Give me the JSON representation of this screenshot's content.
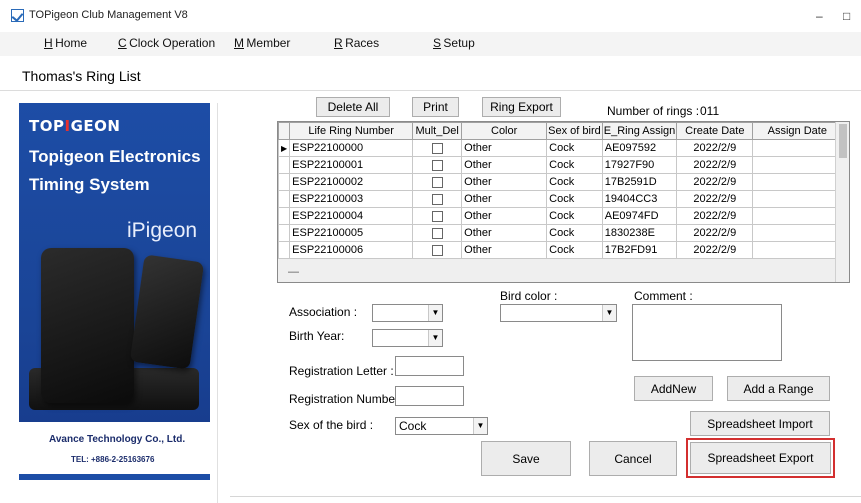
{
  "window": {
    "title": "TOPigeon Club Management V8",
    "minimize_glyph": "–",
    "maximize_glyph": "□"
  },
  "menu": [
    {
      "key": "H",
      "label": "Home"
    },
    {
      "key": "C",
      "label": "Clock Operation"
    },
    {
      "key": "M",
      "label": "Member"
    },
    {
      "key": "R",
      "label": "Races"
    },
    {
      "key": "S",
      "label": "Setup"
    }
  ],
  "page_title": "Thomas's Ring List",
  "banner": {
    "logo_prefix": "TOP",
    "logo_accent": "I",
    "logo_suffix": "GEON",
    "line1": "Topigeon Electronics",
    "line2": "Timing System",
    "product": "iPigeon",
    "company": "Avance Technology Co., Ltd.",
    "tel": "TEL: +886-2-25163676"
  },
  "toolbar": {
    "delete_all": "Delete All",
    "print": "Print",
    "ring_export": "Ring Export",
    "rings_label": "Number of rings :",
    "rings_count": "011"
  },
  "grid": {
    "columns": [
      "Life Ring Number",
      "Mult_Del",
      "Color",
      "Sex of bird",
      "E_Ring Assign",
      "Create Date",
      "Assign Date"
    ],
    "rows": [
      {
        "ring": "ESP22100000",
        "color": "Other",
        "sex": "Cock",
        "e_ring": "AE097592",
        "created": "2022/2/9",
        "assigned": ""
      },
      {
        "ring": "ESP22100001",
        "color": "Other",
        "sex": "Cock",
        "e_ring": "17927F90",
        "created": "2022/2/9",
        "assigned": ""
      },
      {
        "ring": "ESP22100002",
        "color": "Other",
        "sex": "Cock",
        "e_ring": "17B2591D",
        "created": "2022/2/9",
        "assigned": ""
      },
      {
        "ring": "ESP22100003",
        "color": "Other",
        "sex": "Cock",
        "e_ring": "19404CC3",
        "created": "2022/2/9",
        "assigned": ""
      },
      {
        "ring": "ESP22100004",
        "color": "Other",
        "sex": "Cock",
        "e_ring": "AE0974FD",
        "created": "2022/2/9",
        "assigned": ""
      },
      {
        "ring": "ESP22100005",
        "color": "Other",
        "sex": "Cock",
        "e_ring": "1830238E",
        "created": "2022/2/9",
        "assigned": ""
      },
      {
        "ring": "ESP22100006",
        "color": "Other",
        "sex": "Cock",
        "e_ring": "17B2FD91",
        "created": "2022/2/9",
        "assigned": ""
      }
    ],
    "new_row_marker": "—"
  },
  "form": {
    "association_label": "Association :",
    "association_value": "",
    "birth_year_label": "Birth Year:",
    "birth_year_value": "",
    "bird_color_label": "Bird color :",
    "bird_color_value": "",
    "comment_label": "Comment :",
    "registration_letter_label": "Registration Letter :",
    "registration_number_label": "Registration Number :",
    "sex_label": "Sex of the bird :",
    "sex_value": "Cock"
  },
  "actions": {
    "add_new": "AddNew",
    "add_range": "Add a Range",
    "spreadsheet_import": "Spreadsheet Import",
    "save": "Save",
    "cancel": "Cancel",
    "spreadsheet_export": "Spreadsheet Export"
  },
  "colors": {
    "banner_blue": "#1d4da6",
    "logo_accent": "#e9302e",
    "export_highlight": "#d32f2f"
  }
}
